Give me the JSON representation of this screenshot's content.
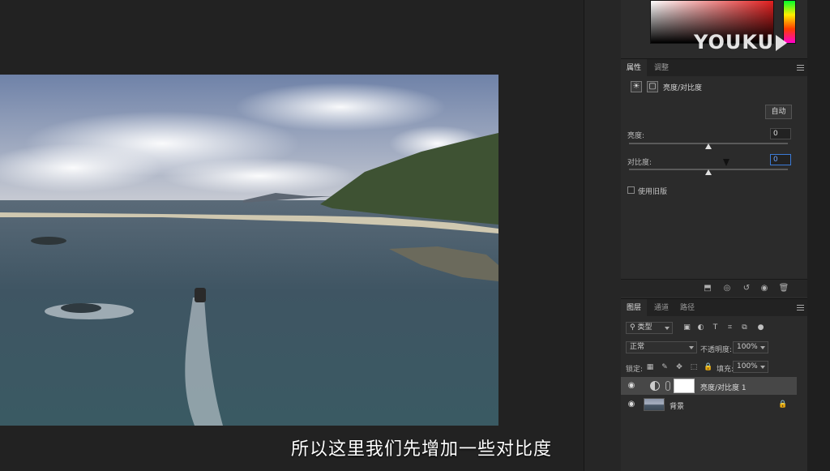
{
  "subtitle": "所以这里我们先增加一些对比度",
  "watermark": "YOUKU",
  "properties_panel": {
    "tabs": [
      "属性",
      "调整"
    ],
    "title": "亮度/对比度",
    "auto_button": "自动",
    "brightness": {
      "label": "亮度:",
      "value": "0",
      "slider_fraction": 0.5
    },
    "contrast": {
      "label": "对比度:",
      "value": "0",
      "slider_fraction": 0.5
    },
    "legacy_checkbox": {
      "label": "使用旧版",
      "checked": false
    }
  },
  "layers_panel": {
    "tabs": [
      "图层",
      "通道",
      "路径"
    ],
    "filter_select": "类型",
    "blend_mode": "正常",
    "opacity_label": "不透明度:",
    "opacity_value": "100%",
    "lock_label": "锁定:",
    "fill_label": "填充:",
    "fill_value": "100%",
    "layers": [
      {
        "name": "亮度/对比度 1",
        "visible": true,
        "selected": true
      },
      {
        "name": "背景",
        "visible": true,
        "selected": false,
        "locked": true
      }
    ]
  },
  "colors": {
    "panel_bg": "#2b2b2b",
    "focus_blue": "#3b7bd6",
    "selected_layer": "#474747"
  },
  "icons": [
    "sun-icon",
    "mask-icon",
    "eye-icon",
    "trash-icon",
    "lock-icon",
    "search-icon",
    "adjustment-icon",
    "chain-icon",
    "menu-icon"
  ]
}
